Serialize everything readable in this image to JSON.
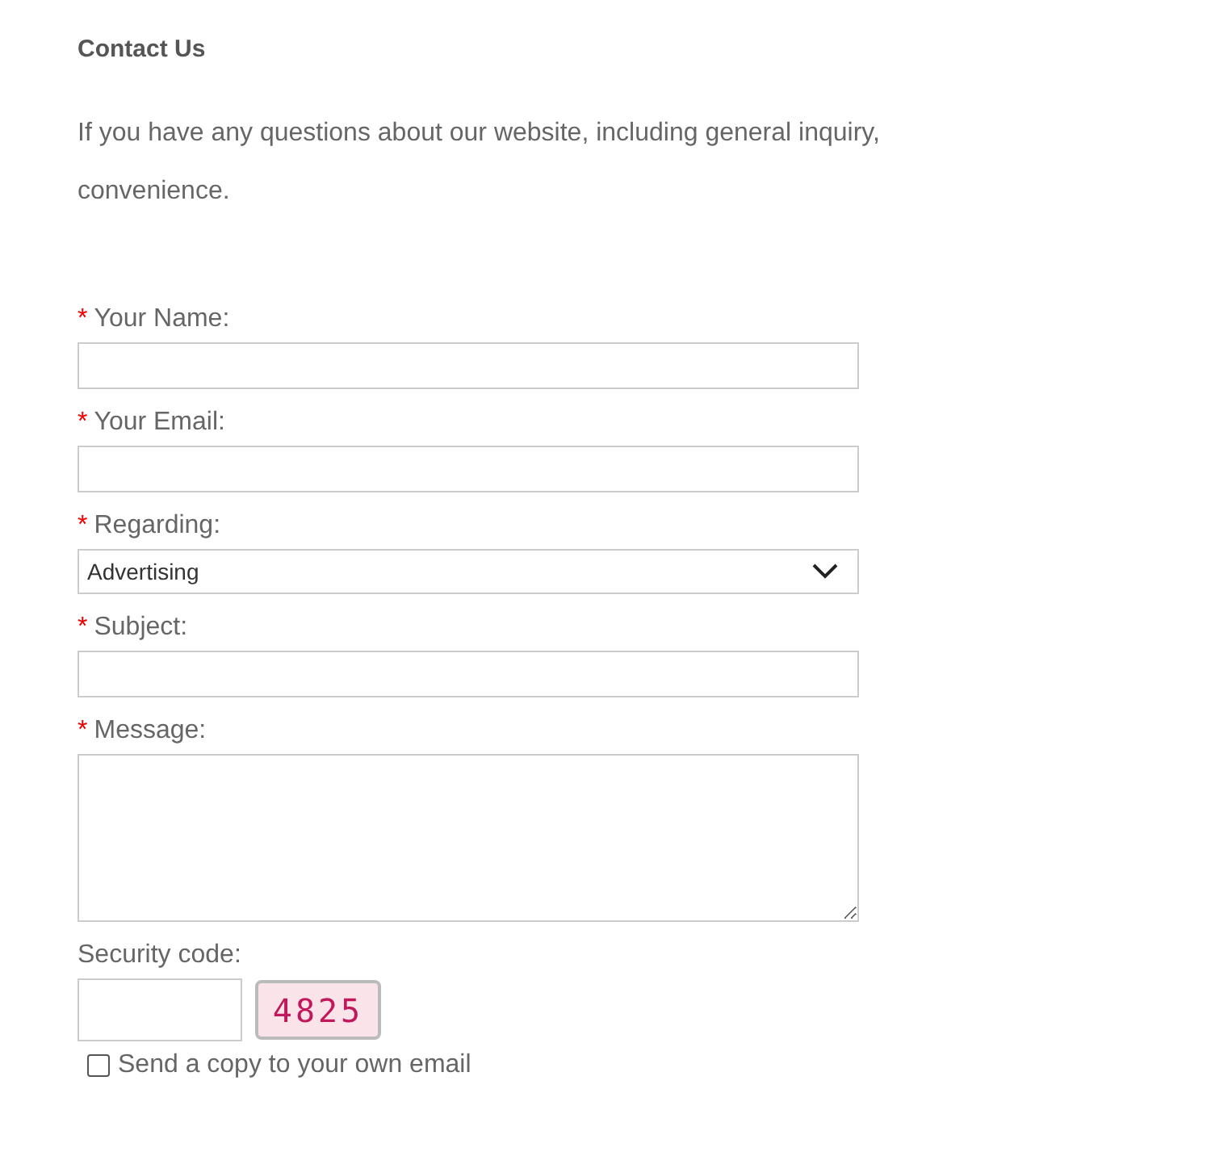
{
  "heading": "Contact Us",
  "intro_lines": [
    "If you have any questions about our website, including general inquiry,",
    "convenience."
  ],
  "fields": [
    {
      "kind": "text",
      "label": "Your Name:",
      "required": true
    },
    {
      "kind": "text",
      "label": "Your Email:",
      "required": true
    },
    {
      "kind": "select",
      "label": "Regarding:",
      "required": true,
      "value": "Advertising"
    },
    {
      "kind": "text",
      "label": "Subject:",
      "required": true
    },
    {
      "kind": "textarea",
      "label": "Message:",
      "required": true
    }
  ],
  "required_mark": "*",
  "security": {
    "label": "Security code:",
    "code": "4825"
  },
  "copy_option": {
    "label": "Send a copy to your own email",
    "checked": false
  }
}
